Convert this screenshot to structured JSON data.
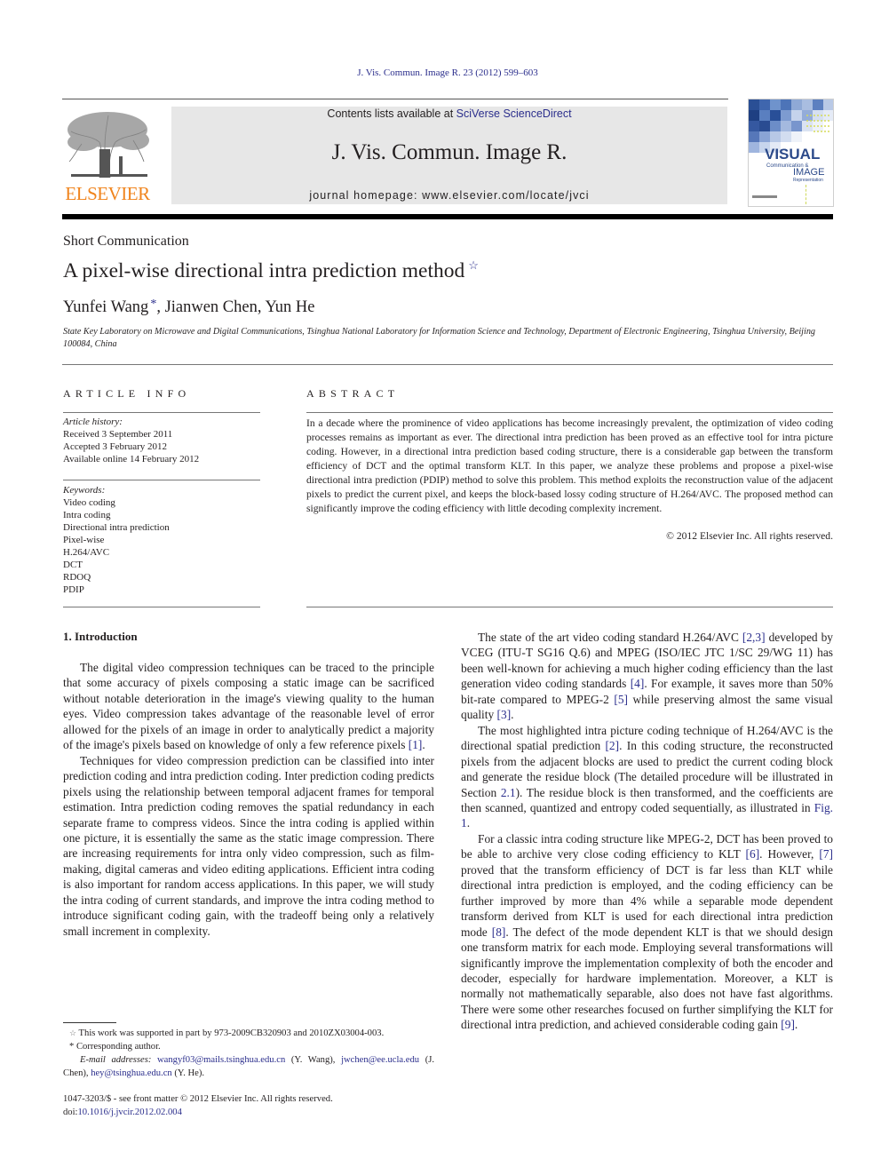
{
  "header": {
    "citation": "J. Vis. Commun. Image R. 23 (2012) 599–603",
    "contents_prefix": "Contents lists available at ",
    "contents_link": "SciVerse ScienceDirect",
    "journal_title": "J. Vis. Commun. Image R.",
    "homepage_prefix": "journal homepage: ",
    "homepage_url": "www.elsevier.com/locate/jvci",
    "publisher_logo_text": "ELSEVIER",
    "cover": {
      "word1": "VISUAL",
      "word2": "Communication &",
      "word3": "IMAGE",
      "word4": "Representation"
    }
  },
  "article": {
    "type": "Short Communication",
    "title": "A pixel-wise directional intra prediction method",
    "title_mark": "☆",
    "authors": [
      {
        "name": "Yunfei Wang",
        "mark": "*"
      },
      {
        "name": "Jianwen Chen"
      },
      {
        "name": "Yun He"
      }
    ],
    "author_separator": ", ",
    "affiliation": "State Key Laboratory on Microwave and Digital Communications, Tsinghua National Laboratory for Information Science and Technology, Department of Electronic Engineering, Tsinghua University, Beijing 100084, China"
  },
  "article_info": {
    "heading": "ARTICLE INFO",
    "history_label": "Article history:",
    "history": [
      "Received 3 September 2011",
      "Accepted 3 February 2012",
      "Available online 14 February 2012"
    ],
    "keywords_label": "Keywords:",
    "keywords": [
      "Video coding",
      "Intra coding",
      "Directional intra prediction",
      "Pixel-wise",
      "H.264/AVC",
      "DCT",
      "RDOQ",
      "PDIP"
    ]
  },
  "abstract": {
    "heading": "ABSTRACT",
    "text": "In a decade where the prominence of video applications has become increasingly prevalent, the optimization of video coding processes remains as important as ever. The directional intra prediction has been proved as an effective tool for intra picture coding. However, in a directional intra prediction based coding structure, there is a considerable gap between the transform efficiency of DCT and the optimal transform KLT. In this paper, we analyze these problems and propose a pixel-wise directional intra prediction (PDIP) method to solve this problem. This method exploits the reconstruction value of the adjacent pixels to predict the current pixel, and keeps the block-based lossy coding structure of H.264/AVC. The proposed method can significantly improve the coding efficiency with little decoding complexity increment.",
    "copyright": "© 2012 Elsevier Inc. All rights reserved."
  },
  "body": {
    "section_heading": "1. Introduction",
    "left_paragraphs": [
      {
        "parts": [
          {
            "t": "The digital video compression techniques can be traced to the principle that some accuracy of pixels composing a static image can be sacrificed without notable deterioration in the image's viewing quality to the human eyes. Video compression takes advantage of the reasonable level of error allowed for the pixels of an image in order to analytically predict a majority of the image's pixels based on knowledge of only a few reference pixels "
          },
          {
            "t": "[1]",
            "link": true
          },
          {
            "t": "."
          }
        ]
      },
      {
        "parts": [
          {
            "t": "Techniques for video compression prediction can be classified into inter prediction coding and intra prediction coding. Inter prediction coding predicts pixels using the relationship between temporal adjacent frames for temporal estimation. Intra prediction coding removes the spatial redundancy in each separate frame to compress videos. Since the intra coding is applied within one picture, it is essentially the same as the static image compression. There are increasing requirements for intra only video compression, such as film-making, digital cameras and video editing applications. Efficient intra coding is also important for random access applications. In this paper, we will study the intra coding of current standards, and improve the intra coding method to introduce significant coding gain, with the tradeoff being only a relatively small increment in complexity."
          }
        ]
      }
    ],
    "right_paragraphs": [
      {
        "parts": [
          {
            "t": "The state of the art video coding standard H.264/AVC "
          },
          {
            "t": "[2,3]",
            "link": true
          },
          {
            "t": " developed by VCEG (ITU-T SG16 Q.6) and MPEG (ISO/IEC JTC 1/SC 29/WG 11) has been well-known for achieving a much higher coding efficiency than the last generation video coding standards "
          },
          {
            "t": "[4]",
            "link": true
          },
          {
            "t": ". For example, it saves more than 50% bit-rate compared to MPEG-2 "
          },
          {
            "t": "[5]",
            "link": true
          },
          {
            "t": " while preserving almost the same visual quality "
          },
          {
            "t": "[3]",
            "link": true
          },
          {
            "t": "."
          }
        ]
      },
      {
        "parts": [
          {
            "t": "The most highlighted intra picture coding technique of H.264/AVC is the directional spatial prediction "
          },
          {
            "t": "[2]",
            "link": true
          },
          {
            "t": ". In this coding structure, the reconstructed pixels from the adjacent blocks are used to predict the current coding block and generate the residue block (The detailed procedure will be illustrated in Section "
          },
          {
            "t": "2.1",
            "link": true
          },
          {
            "t": "). The residue block is then transformed, and the coefficients are then scanned, quantized and entropy coded sequentially, as illustrated in "
          },
          {
            "t": "Fig. 1",
            "link": true
          },
          {
            "t": "."
          }
        ]
      },
      {
        "parts": [
          {
            "t": "For a classic intra coding structure like MPEG-2, DCT has been proved to be able to archive very close coding efficiency to KLT "
          },
          {
            "t": "[6]",
            "link": true
          },
          {
            "t": ". However, "
          },
          {
            "t": "[7]",
            "link": true
          },
          {
            "t": " proved that the transform efficiency of DCT is far less than KLT while directional intra prediction is employed, and the coding efficiency can be further improved by more than 4% while a separable mode dependent transform derived from KLT is used for each directional intra prediction mode "
          },
          {
            "t": "[8]",
            "link": true
          },
          {
            "t": ". The defect of the mode dependent KLT is that we should design one transform matrix for each mode. Employing several transformations will significantly improve the implementation complexity of both the encoder and decoder, especially for hardware implementation. Moreover, a KLT is normally not mathematically separable, also does not have fast algorithms. There were some other researches focused on further simplifying the KLT for directional intra prediction, and achieved considerable coding gain "
          },
          {
            "t": "[9]",
            "link": true
          },
          {
            "t": "."
          }
        ]
      }
    ]
  },
  "footnotes": {
    "funding_mark": "☆",
    "funding": "This work was supported in part by 973-2009CB320903 and 2010ZX03004-003.",
    "corresponding_mark": "*",
    "corresponding": "Corresponding author.",
    "email_label": "E-mail addresses:",
    "emails": [
      {
        "address": "wangyf03@mails.tsinghua.edu.cn",
        "who": " (Y. Wang), "
      },
      {
        "address": "jwchen@ee.ucla.edu",
        "who": " (J. Chen), "
      },
      {
        "address": "hey@tsinghua.edu.cn",
        "who": " (Y. He)."
      }
    ]
  },
  "front_matter": {
    "issn_line": "1047-3203/$ - see front matter © 2012 Elsevier Inc. All rights reserved.",
    "doi_prefix": "doi:",
    "doi": "10.1016/j.jvcir.2012.02.004"
  },
  "colors": {
    "link": "#2b2e8c",
    "elsevier_orange": "#f0841d",
    "masthead_bg": "#e7e7e7"
  }
}
